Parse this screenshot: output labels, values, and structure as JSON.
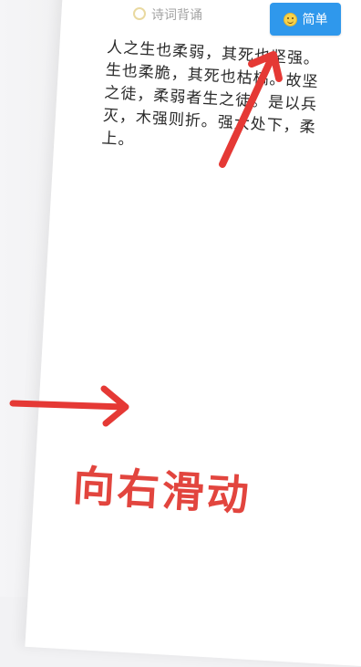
{
  "app": {
    "name": "诗词背诵"
  },
  "difficulty_button": {
    "label": "简单"
  },
  "poem": {
    "lines": [
      "人之生也柔弱，其死也坚强。",
      "生也柔脆，其死也枯槁。故坚",
      "之徒，柔弱者生之徒。是以兵",
      "灭，木强则折。强大处下，柔",
      "上。"
    ]
  },
  "overlay": {
    "caption": "向右滑动"
  },
  "colors": {
    "accent": "#2f98ec",
    "arrow": "#e53935",
    "caption": "#e2453e"
  }
}
